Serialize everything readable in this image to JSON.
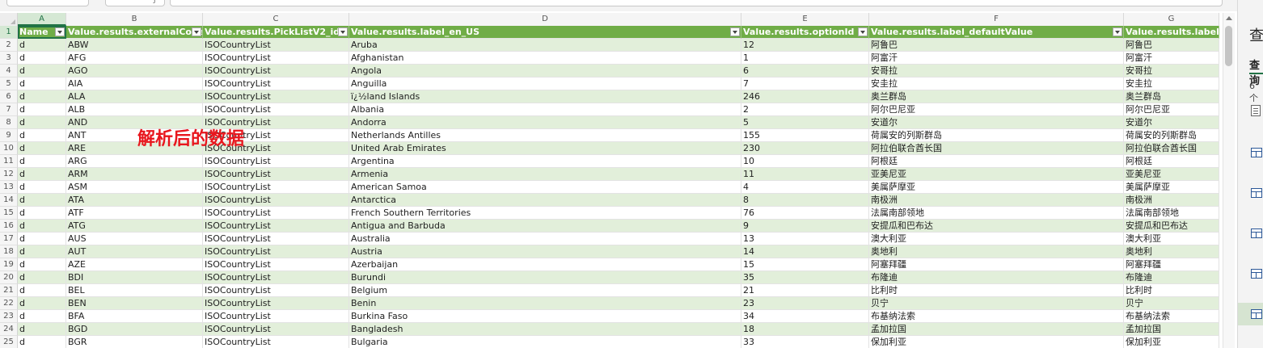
{
  "column_letters": [
    "A",
    "B",
    "C",
    "D",
    "E",
    "F",
    "G"
  ],
  "headers": [
    "Name",
    "Value.results.externalCode",
    "Value.results.PickListV2_id",
    "Value.results.label_en_US",
    "Value.results.optionId",
    "Value.results.label_defaultValue",
    "Value.results.label_zh"
  ],
  "row_numbers": [
    "1",
    "2",
    "3",
    "4",
    "5",
    "6",
    "7",
    "8",
    "9",
    "10",
    "11",
    "12",
    "13",
    "14",
    "15",
    "16",
    "17",
    "18",
    "19",
    "20",
    "21",
    "22",
    "23",
    "24",
    "25"
  ],
  "rows": [
    [
      "d",
      "ABW",
      "ISOCountryList",
      "Aruba",
      "12",
      "阿鲁巴",
      "阿鲁巴"
    ],
    [
      "d",
      "AFG",
      "ISOCountryList",
      "Afghanistan",
      "1",
      "阿富汗",
      "阿富汗"
    ],
    [
      "d",
      "AGO",
      "ISOCountryList",
      "Angola",
      "6",
      "安哥拉",
      "安哥拉"
    ],
    [
      "d",
      "AIA",
      "ISOCountryList",
      "Anguilla",
      "7",
      "安圭拉",
      "安圭拉"
    ],
    [
      "d",
      "ALA",
      "ISOCountryList",
      "ï¿½land Islands",
      "246",
      "奥兰群岛",
      "奥兰群岛"
    ],
    [
      "d",
      "ALB",
      "ISOCountryList",
      "Albania",
      "2",
      "阿尔巴尼亚",
      "阿尔巴尼亚"
    ],
    [
      "d",
      "AND",
      "ISOCountryList",
      "Andorra",
      "5",
      "安道尔",
      "安道尔"
    ],
    [
      "d",
      "ANT",
      "ISOCountryList",
      "Netherlands Antilles",
      "155",
      "荷属安的列斯群岛",
      "荷属安的列斯群岛"
    ],
    [
      "d",
      "ARE",
      "ISOCountryList",
      "United Arab Emirates",
      "230",
      "阿拉伯联合酋长国",
      "阿拉伯联合酋长国"
    ],
    [
      "d",
      "ARG",
      "ISOCountryList",
      "Argentina",
      "10",
      "阿根廷",
      "阿根廷"
    ],
    [
      "d",
      "ARM",
      "ISOCountryList",
      "Armenia",
      "11",
      "亚美尼亚",
      "亚美尼亚"
    ],
    [
      "d",
      "ASM",
      "ISOCountryList",
      "American Samoa",
      "4",
      "美属萨摩亚",
      "美属萨摩亚"
    ],
    [
      "d",
      "ATA",
      "ISOCountryList",
      "Antarctica",
      "8",
      "南极洲",
      "南极洲"
    ],
    [
      "d",
      "ATF",
      "ISOCountryList",
      "French Southern Territories",
      "76",
      "法属南部领地",
      "法属南部领地"
    ],
    [
      "d",
      "ATG",
      "ISOCountryList",
      "Antigua and Barbuda",
      "9",
      "安提瓜和巴布达",
      "安提瓜和巴布达"
    ],
    [
      "d",
      "AUS",
      "ISOCountryList",
      "Australia",
      "13",
      "澳大利亚",
      "澳大利亚"
    ],
    [
      "d",
      "AUT",
      "ISOCountryList",
      "Austria",
      "14",
      "奥地利",
      "奥地利"
    ],
    [
      "d",
      "AZE",
      "ISOCountryList",
      "Azerbaijan",
      "15",
      "阿塞拜疆",
      "阿塞拜疆"
    ],
    [
      "d",
      "BDI",
      "ISOCountryList",
      "Burundi",
      "35",
      "布隆迪",
      "布隆迪"
    ],
    [
      "d",
      "BEL",
      "ISOCountryList",
      "Belgium",
      "21",
      "比利时",
      "比利时"
    ],
    [
      "d",
      "BEN",
      "ISOCountryList",
      "Benin",
      "23",
      "贝宁",
      "贝宁"
    ],
    [
      "d",
      "BFA",
      "ISOCountryList",
      "Burkina Faso",
      "34",
      "布基纳法索",
      "布基纳法索"
    ],
    [
      "d",
      "BGD",
      "ISOCountryList",
      "Bangladesh",
      "18",
      "孟加拉国",
      "孟加拉国"
    ],
    [
      "d",
      "BGR",
      "ISOCountryList",
      "Bulgaria",
      "33",
      "保加利亚",
      "保加利亚"
    ]
  ],
  "annotation": "解析后的数据",
  "side_pane": {
    "title": "查",
    "tab": "查询",
    "count": "6 个"
  },
  "colors": {
    "header_fill": "#70ad47",
    "band_fill": "#e2efda",
    "annotation": "#e8161d",
    "selection": "#217346"
  },
  "icons": [
    "filter-dropdown-icon",
    "table-icon",
    "list-icon"
  ]
}
